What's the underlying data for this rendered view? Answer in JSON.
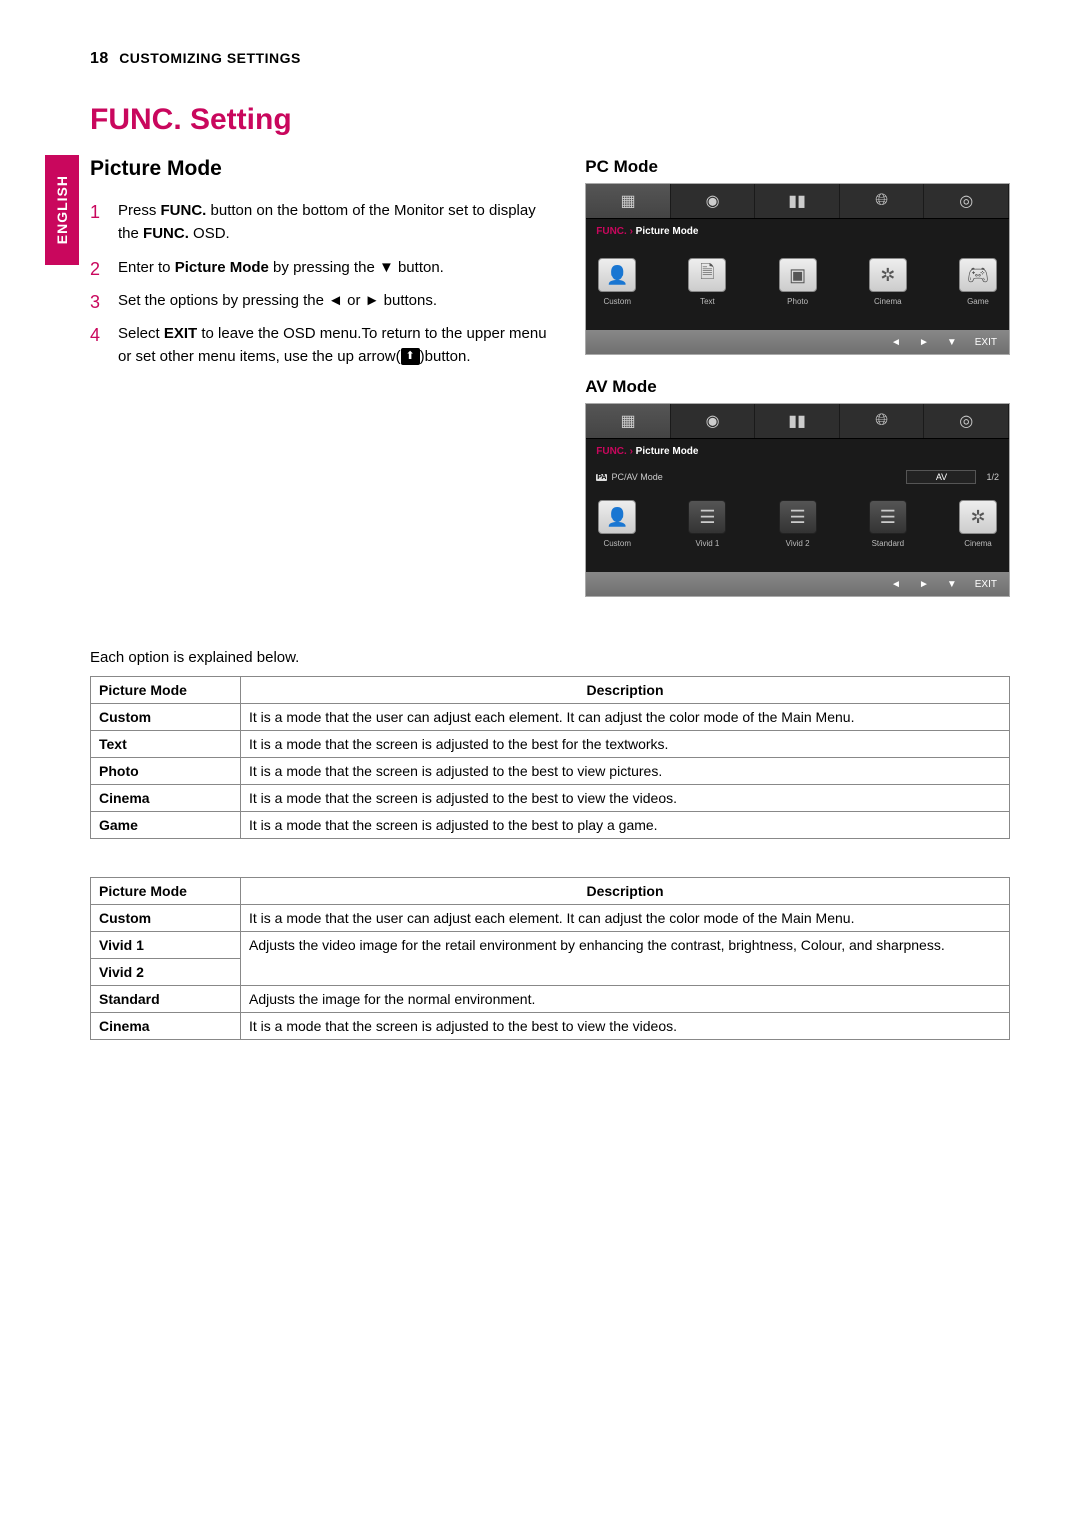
{
  "header": {
    "page_number": "18",
    "section": "CUSTOMIZING SETTINGS"
  },
  "side_tab": "ENGLISH",
  "title": "FUNC. Setting",
  "subtitle": "Picture Mode",
  "steps": [
    {
      "pre": "Press ",
      "b1": "FUNC.",
      "mid": " button on   the bottom of the Monitor set to display the ",
      "b2": "FUNC.",
      "post": " OSD."
    },
    {
      "pre": "Enter to ",
      "b1": "Picture Mode",
      "mid": " by pressing the ▼ button.",
      "b2": "",
      "post": ""
    },
    {
      "pre": "Set the options by pressing the ◄ or ► buttons.",
      "b1": "",
      "mid": "",
      "b2": "",
      "post": ""
    },
    {
      "pre": "Select ",
      "b1": "EXIT",
      "mid": " to leave the OSD menu.To return to the upper menu or set other menu items, use  the  up arrow(",
      "b2": "",
      "post": ")button."
    }
  ],
  "pc_mode": {
    "label": "PC Mode",
    "breadcrumb_func": "FUNC.  ›",
    "breadcrumb_item": "  Picture Mode",
    "modes": [
      "Custom",
      "Text",
      "Photo",
      "Cinema",
      "Game"
    ],
    "footer": {
      "arrows": [
        "◄",
        "►",
        "▼"
      ],
      "exit": "EXIT"
    }
  },
  "av_mode": {
    "label": "AV Mode",
    "breadcrumb_func": "FUNC.  ›",
    "breadcrumb_item": "  Picture Mode",
    "row_label": "PC/AV Mode",
    "row_value": "AV",
    "page_indicator": "1/2",
    "modes": [
      "Custom",
      "Vivid 1",
      "Vivid 2",
      "Standard",
      "Cinema"
    ],
    "footer": {
      "arrows": [
        "◄",
        "►",
        "▼"
      ],
      "exit": "EXIT"
    }
  },
  "intro_line": "Each option is explained below.",
  "table1": {
    "head": [
      "Picture Mode",
      "Description"
    ],
    "rows": [
      [
        "Custom",
        "It is a mode that the user can adjust each element. It can adjust the color mode of the Main Menu."
      ],
      [
        "Text",
        "It is a mode that the screen is adjusted to the best for the textworks."
      ],
      [
        "Photo",
        "It is a mode that the screen is adjusted to the best to view pictures."
      ],
      [
        "Cinema",
        "It is a mode that the screen is adjusted to the best to view the videos."
      ],
      [
        "Game",
        "It is a mode that the screen is adjusted to the best to play a game."
      ]
    ]
  },
  "table2": {
    "head": [
      "Picture Mode",
      "Description"
    ],
    "rows": [
      [
        "Custom",
        "It is a mode that the user can adjust each element. It can adjust the color mode of the Main Menu."
      ],
      [
        "Vivid 1",
        "Adjusts the video image for the retail environment by enhancing the contrast, brightness, Colour, and sharpness."
      ],
      [
        "Vivid 2",
        ""
      ],
      [
        "Standard",
        "Adjusts the image for the normal environment."
      ],
      [
        "Cinema",
        "It is a mode that the screen is adjusted to the best to view the videos."
      ]
    ]
  }
}
